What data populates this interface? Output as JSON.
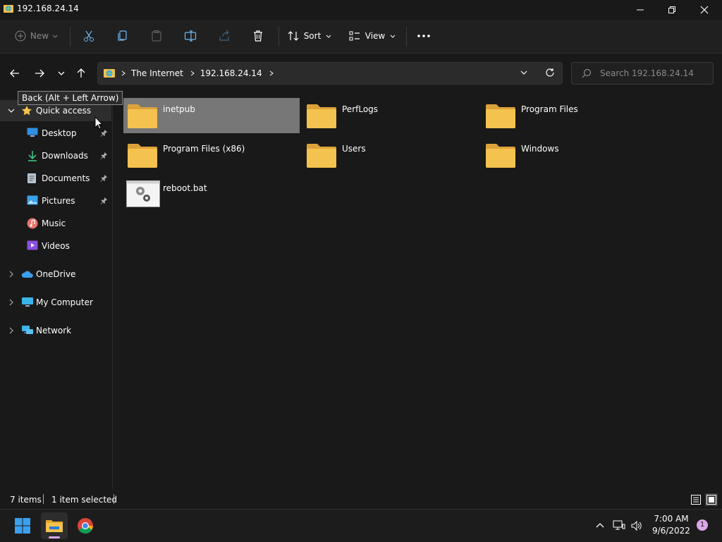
{
  "window": {
    "title": "192.168.24.14"
  },
  "commandbar": {
    "new_label": "New",
    "sort_label": "Sort",
    "view_label": "View"
  },
  "address": {
    "crumbs": [
      "The Internet",
      "192.168.24.14"
    ]
  },
  "search": {
    "placeholder": "Search 192.168.24.14"
  },
  "tooltip": {
    "text": "Back (Alt + Left Arrow)"
  },
  "sidebar": {
    "quick_access": "Quick access",
    "items": [
      {
        "label": "Desktop",
        "icon": "desktop-icon",
        "pinned": true
      },
      {
        "label": "Downloads",
        "icon": "downloads-icon",
        "pinned": true
      },
      {
        "label": "Documents",
        "icon": "documents-icon",
        "pinned": true
      },
      {
        "label": "Pictures",
        "icon": "pictures-icon",
        "pinned": true
      },
      {
        "label": "Music",
        "icon": "music-icon",
        "pinned": false
      },
      {
        "label": "Videos",
        "icon": "videos-icon",
        "pinned": false
      }
    ],
    "roots": [
      {
        "label": "OneDrive",
        "icon": "onedrive-icon"
      },
      {
        "label": "My Computer",
        "icon": "computer-icon"
      },
      {
        "label": "Network",
        "icon": "network-icon"
      }
    ]
  },
  "files": [
    {
      "name": "inetpub",
      "type": "folder",
      "selected": true
    },
    {
      "name": "PerfLogs",
      "type": "folder",
      "selected": false
    },
    {
      "name": "Program Files",
      "type": "folder",
      "selected": false
    },
    {
      "name": "Program Files (x86)",
      "type": "folder",
      "selected": false
    },
    {
      "name": "Users",
      "type": "folder",
      "selected": false
    },
    {
      "name": "Windows",
      "type": "folder",
      "selected": false
    },
    {
      "name": "reboot.bat",
      "type": "batch-file",
      "selected": false
    }
  ],
  "status": {
    "item_count": "7 items",
    "selection": "1 item selected"
  },
  "taskbar": {
    "time": "7:00 AM",
    "date": "9/6/2022",
    "notification_count": "1"
  },
  "colors": {
    "folder": "#F4C24E",
    "selection": "#777777",
    "accent": "#0078D4"
  }
}
